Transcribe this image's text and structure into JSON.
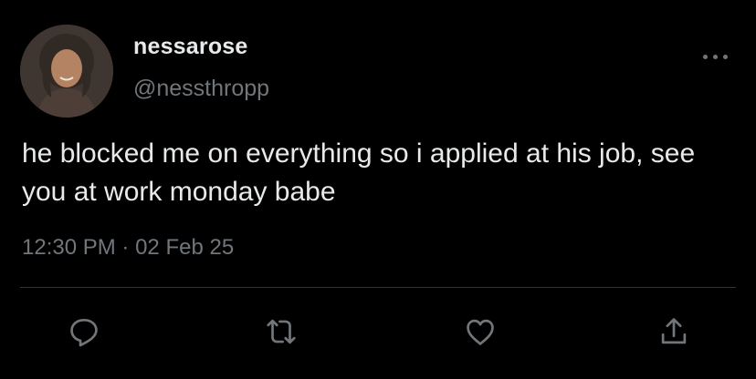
{
  "user": {
    "display_name": "nessarose",
    "handle": "@nessthropp",
    "avatar": "profile-photo"
  },
  "tweet": {
    "text": "he blocked me on everything so i applied at his job, see you at work monday babe",
    "time": "12:30 PM",
    "separator": "·",
    "date": "02 Feb 25"
  },
  "actions": [
    {
      "name": "reply",
      "icon": "speech-bubble-icon"
    },
    {
      "name": "retweet",
      "icon": "retweet-arrows-icon"
    },
    {
      "name": "like",
      "icon": "heart-icon"
    },
    {
      "name": "share",
      "icon": "share-upload-icon"
    }
  ],
  "colors": {
    "background": "#000000",
    "primary_text": "#e7e9ea",
    "secondary_text": "#71767b",
    "divider": "#2f3336"
  }
}
